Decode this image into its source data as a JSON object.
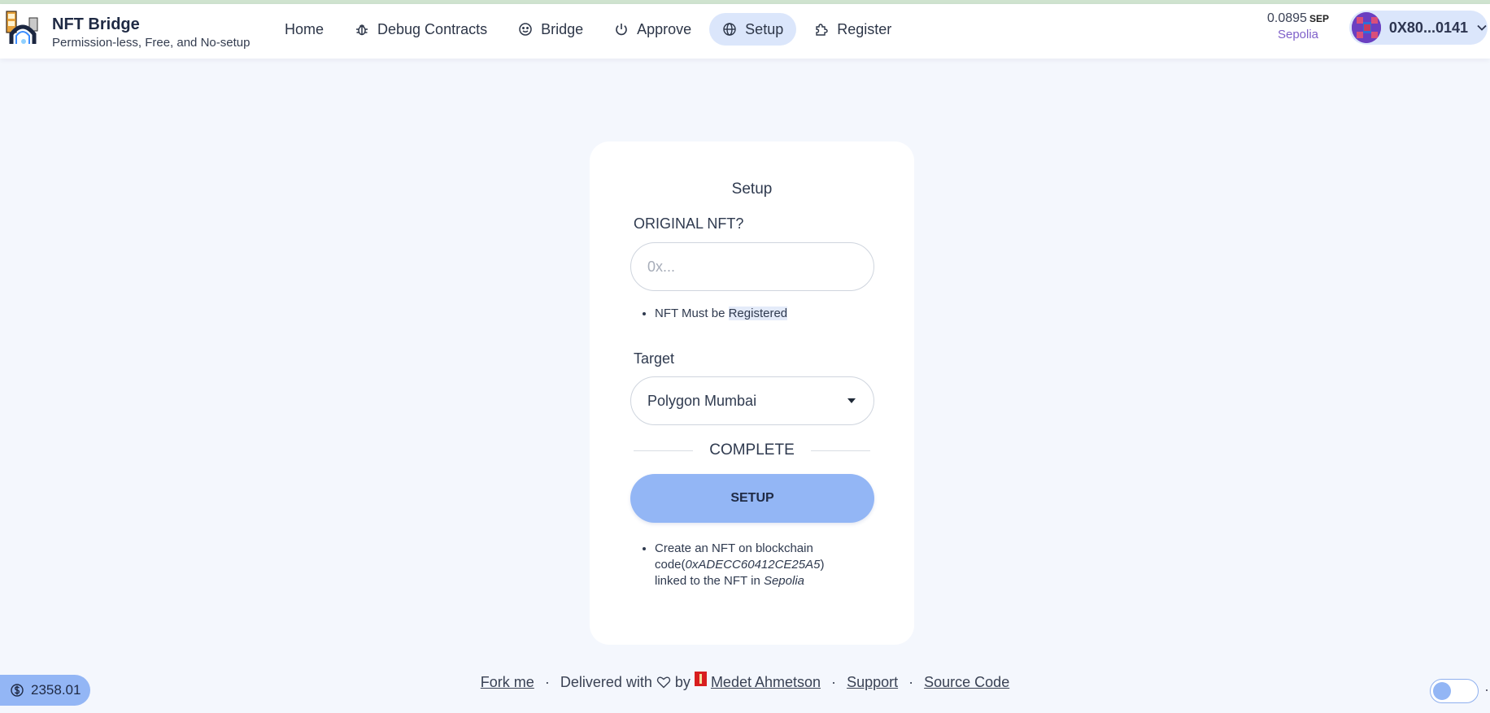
{
  "header": {
    "brand_title": "NFT Bridge",
    "brand_subtitle": "Permission-less, Free, and No-setup",
    "nav": [
      {
        "label": "Home",
        "icon": "none",
        "active": false
      },
      {
        "label": "Debug Contracts",
        "icon": "bug-icon",
        "active": false
      },
      {
        "label": "Bridge",
        "icon": "smile-icon",
        "active": false
      },
      {
        "label": "Approve",
        "icon": "power-icon",
        "active": false
      },
      {
        "label": "Setup",
        "icon": "globe-icon",
        "active": true
      },
      {
        "label": "Register",
        "icon": "puzzle-icon",
        "active": false
      }
    ],
    "balance": {
      "amount": "0.0895",
      "symbol": "SEP",
      "network": "Sepolia"
    },
    "account": {
      "address": "0X80...0141"
    }
  },
  "card": {
    "title": "Setup",
    "original_label": "ORIGINAL NFT?",
    "original_placeholder": "0x...",
    "note_prefix": "NFT Must be ",
    "note_highlight": "Registered",
    "target_label": "Target",
    "target_value": "Polygon Mumbai",
    "divider_text": "COMPLETE",
    "button_label": "SETUP",
    "desc_part1": "Create an NFT on blockchain code(",
    "desc_code": "0xADECC60412CE25A5",
    "desc_part2": ") linked to the NFT in ",
    "desc_network": "Sepolia"
  },
  "footer": {
    "fork": "Fork me",
    "delivered": "Delivered with",
    "by": "by",
    "author": "Medet Ahmetson",
    "support": "Support",
    "source": "Source Code"
  },
  "price_pill": {
    "value": "2358.01",
    "icon": "dollar-circle-icon"
  },
  "colors": {
    "accent": "#93b6f5",
    "active_nav": "#dbe6fb",
    "background": "#f4f7fd",
    "network": "#7f60c9"
  }
}
